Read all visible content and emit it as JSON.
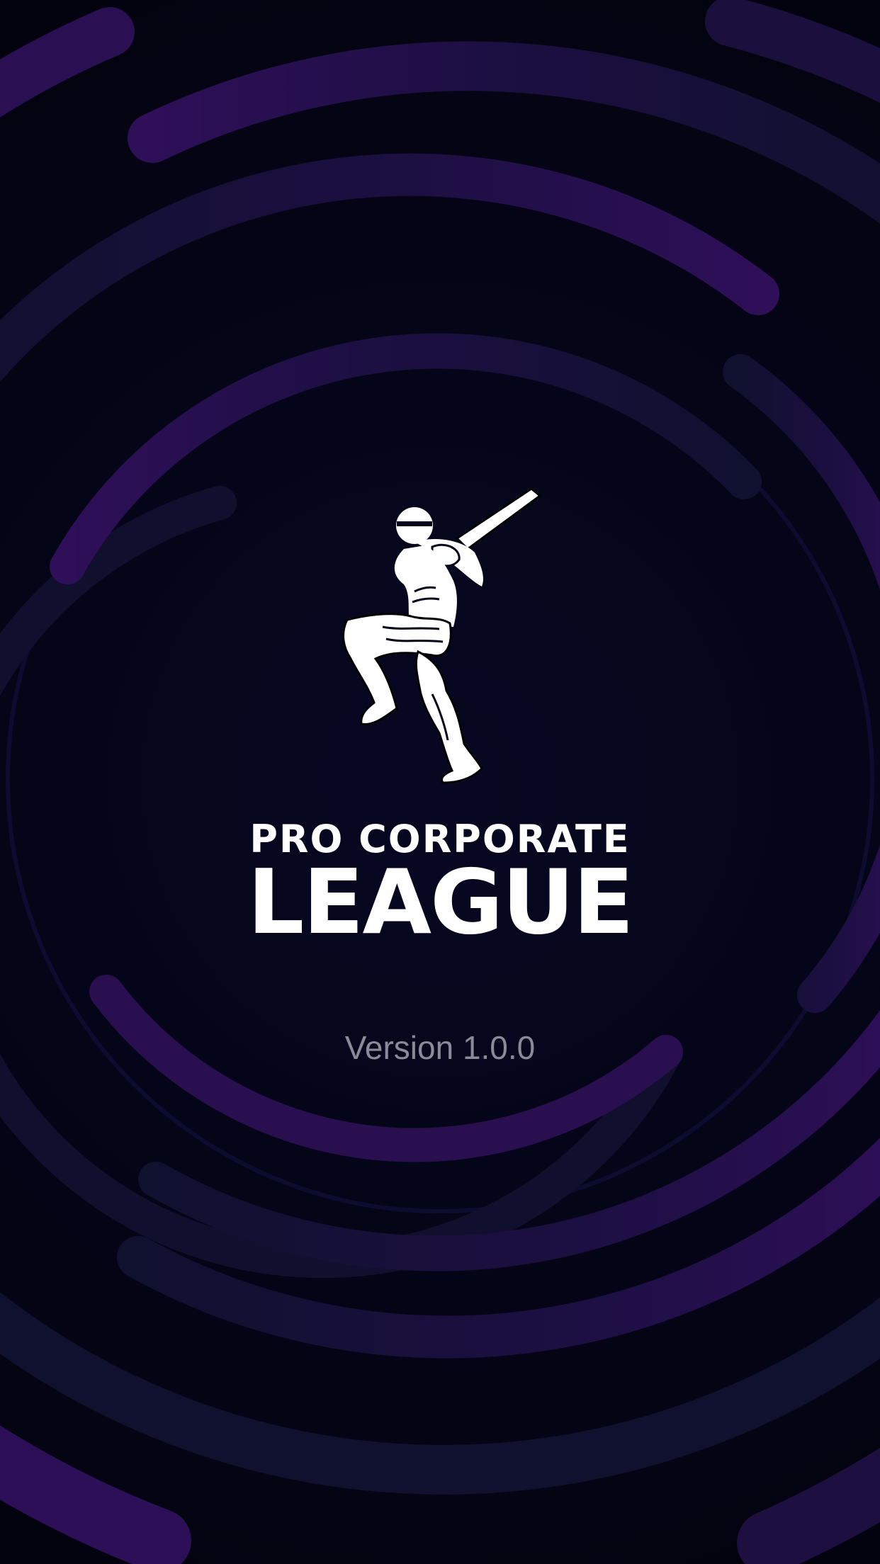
{
  "splash": {
    "brand": {
      "line1": "PRO CORPORATE",
      "line2": "LEAGUE"
    },
    "logo_icon": "cricket-batsman-icon",
    "version": "Version 1.0.0"
  },
  "colors": {
    "background": "#04041a",
    "ring_dark": "#101033",
    "ring_purple": "#2d0f55",
    "text_primary": "#ffffff",
    "text_version": "#8a8a98"
  }
}
